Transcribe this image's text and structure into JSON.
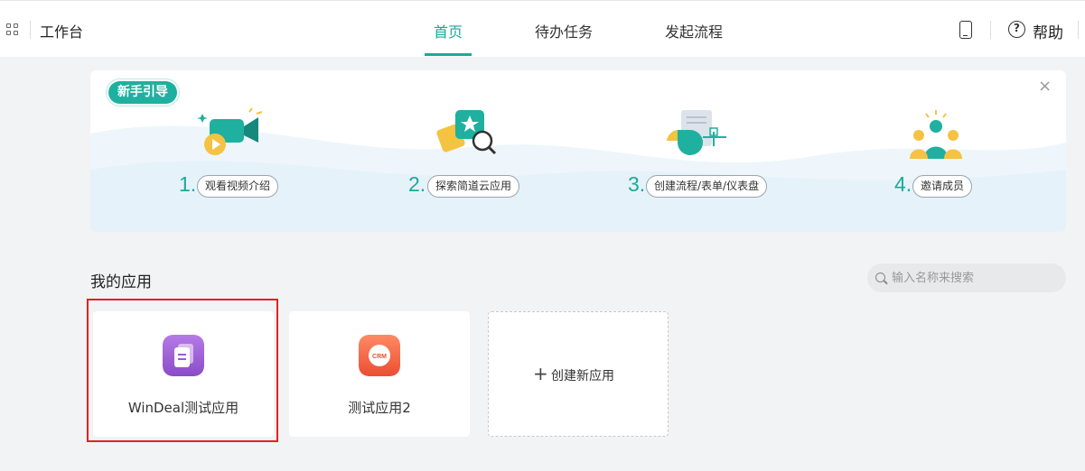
{
  "header": {
    "workspace_title": "工作台",
    "tabs": [
      {
        "label": "首页",
        "active": true
      },
      {
        "label": "待办任务",
        "active": false
      },
      {
        "label": "发起流程",
        "active": false
      }
    ],
    "help_label": "帮助",
    "icons": [
      "apps-grid-icon",
      "mobile-phone-icon",
      "help-circle-icon"
    ]
  },
  "guide": {
    "badge": "新手引导",
    "close_symbol": "×",
    "steps": [
      {
        "number": "1.",
        "label": "观看视频介绍",
        "icon": "video-camera-icon"
      },
      {
        "number": "2.",
        "label": "探索简道云应用",
        "icon": "explore-apps-icon"
      },
      {
        "number": "3.",
        "label": "创建流程/表单/仪表盘",
        "icon": "create-form-chart-icon"
      },
      {
        "number": "4.",
        "label": "邀请成员",
        "icon": "invite-members-icon"
      }
    ]
  },
  "apps": {
    "section_title": "我的应用",
    "search_placeholder": "输入名称来搜索",
    "items": [
      {
        "name": "WinDeal测试应用",
        "icon": "document-app-icon",
        "icon_color": "#9b59d0",
        "highlighted": true
      },
      {
        "name": "测试应用2",
        "icon": "crm-app-icon",
        "icon_color": "#f0603c",
        "icon_text": "CRM",
        "highlighted": false
      }
    ],
    "create_plus": "+",
    "create_label": "创建新应用"
  },
  "colors": {
    "accent": "#1aa99a",
    "highlight_border": "#e5201f"
  }
}
